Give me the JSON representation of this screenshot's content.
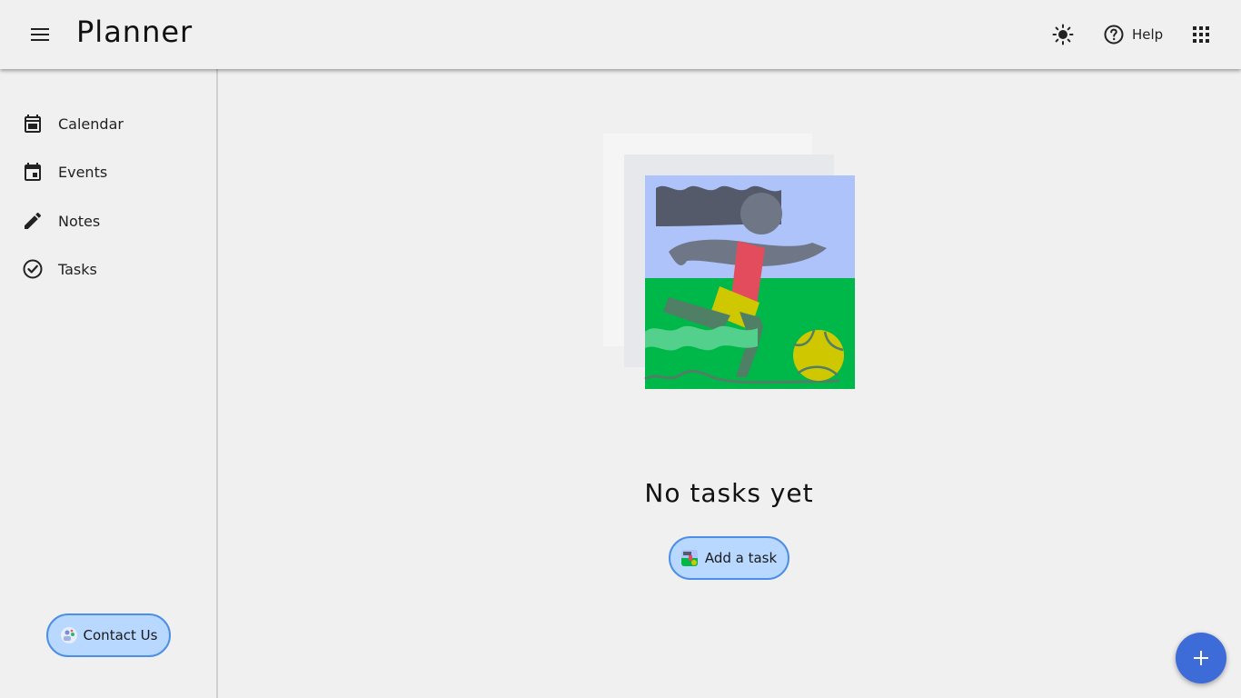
{
  "header": {
    "title": "Planner",
    "help_label": "Help",
    "icons": {
      "menu": "hamburger-menu-icon",
      "theme": "sun-icon",
      "help": "help-circle-icon",
      "apps": "apps-grid-icon"
    }
  },
  "sidebar": {
    "items": [
      {
        "label": "Calendar",
        "icon": "calendar-icon"
      },
      {
        "label": "Events",
        "icon": "event-icon"
      },
      {
        "label": "Notes",
        "icon": "pencil-icon"
      },
      {
        "label": "Tasks",
        "icon": "check-circle-icon"
      }
    ],
    "contact_label": "Contact Us"
  },
  "main": {
    "empty_title": "No tasks yet",
    "add_task_label": "Add a task"
  },
  "fab": {
    "icon": "plus-icon"
  },
  "colors": {
    "background": "#f0f0f0",
    "button_fill": "#b9d8ff",
    "button_border": "#4c8fe6",
    "fab": "#3d6bd8"
  }
}
